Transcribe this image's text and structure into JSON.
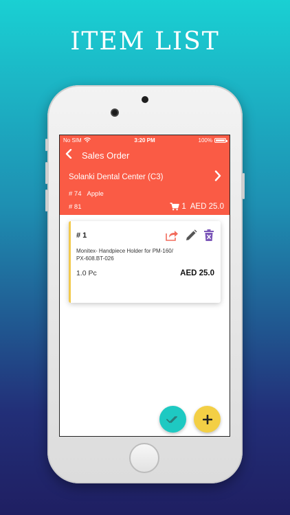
{
  "promo": {
    "title": "ITEM LIST"
  },
  "status_bar": {
    "carrier": "No SIM",
    "time": "3:20 PM",
    "battery": "100%"
  },
  "header": {
    "title": "Sales Order",
    "customer": "Solanki Dental Center (C3)",
    "order_number": "# 74",
    "brand": "Apple",
    "secondary_number": "# 81",
    "cart_count": "1",
    "total": "AED 25.0"
  },
  "items": [
    {
      "number": "# 1",
      "description_line1": "Monitex- Handpiece Holder for PM-160/",
      "description_line2": "PX-608.BT-026",
      "quantity": "1.0 Pc",
      "price": "AED 25.0"
    }
  ],
  "colors": {
    "accent": "#fa5b45",
    "fab_confirm": "#1ec9c2",
    "fab_add": "#f3cf45",
    "share_icon": "#f26b5b",
    "edit_icon": "#555555",
    "delete_icon": "#7b56b8",
    "card_stripe": "#f2c94c"
  },
  "icons": {
    "back": "back-arrow-icon",
    "forward": "chevron-right-icon",
    "cart": "cart-icon",
    "share": "share-icon",
    "edit": "pencil-icon",
    "delete": "trash-icon",
    "confirm": "double-check-icon",
    "add": "plus-icon"
  }
}
